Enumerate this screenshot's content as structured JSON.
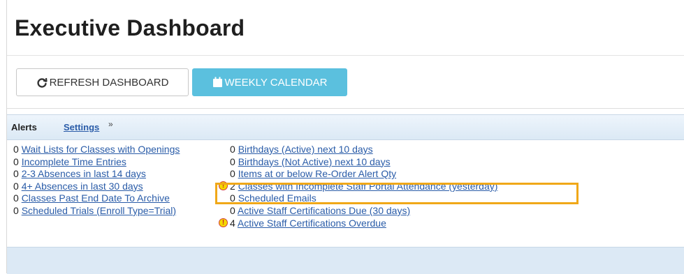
{
  "page": {
    "title": "Executive Dashboard"
  },
  "toolbar": {
    "refresh_label": "REFRESH DASHBOARD",
    "calendar_label": "WEEKLY CALENDAR"
  },
  "alerts": {
    "label": "Alerts",
    "settings_label": "Settings",
    "expand_icon": "double-chevron-down-icon",
    "left": [
      {
        "count": "0",
        "text": "Wait Lists for Classes with Openings"
      },
      {
        "count": "0",
        "text": "Incomplete Time Entries"
      },
      {
        "count": "0",
        "text": "2-3 Absences in last 14 days"
      },
      {
        "count": "0",
        "text": "4+ Absences in last 30 days"
      },
      {
        "count": "0",
        "text": "Classes Past End Date To Archive"
      },
      {
        "count": "0",
        "text": "Scheduled Trials (Enroll Type=Trial)"
      }
    ],
    "right": [
      {
        "count": "0",
        "text": "Birthdays (Active) next 10 days",
        "warning": false
      },
      {
        "count": "0",
        "text": "Birthdays (Not Active) next 10 days",
        "warning": false
      },
      {
        "count": "0",
        "text": "Items at or below Re-Order Alert Qty",
        "warning": false
      },
      {
        "count": "2",
        "text": "Classes with Incomplete Staff Portal Attendance (yesterday)",
        "warning": true
      },
      {
        "count": "0",
        "text": "Scheduled Emails",
        "warning": false
      },
      {
        "count": "0",
        "text": "Active Staff Certifications Due (30 days)",
        "warning": false
      },
      {
        "count": "4",
        "text": "Active Staff Certifications Overdue",
        "warning": true
      }
    ],
    "warning_symbol": "!"
  },
  "colors": {
    "link": "#2a5ca8",
    "calendar_button": "#5bc0de",
    "highlight_border": "#f0a818",
    "warning_fill": "#f5d800"
  }
}
